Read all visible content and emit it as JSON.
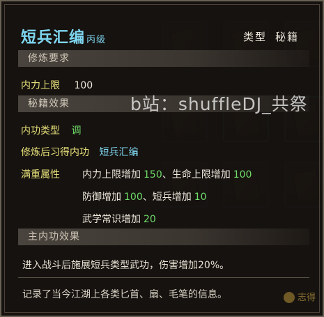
{
  "item": {
    "title": "短兵汇编",
    "title_suffix": "丙级",
    "type_heading": "类型",
    "type_value": "秘籍"
  },
  "sections": {
    "requirements": "修炼要求",
    "effects": "秘籍效果",
    "main_effect": "主内功效果"
  },
  "requirements": {
    "label": "内力上限",
    "value": "100"
  },
  "effects": {
    "inner_type_label": "内功类型",
    "inner_type_value": "调",
    "learned_label": "修炼后习得内功",
    "learned_value": "短兵汇编",
    "fullstack_label": "满重属性",
    "lines": [
      {
        "a_label": "内力上限增加",
        "a_value": "150",
        "sep": "、",
        "b_label": "生命上限增加",
        "b_value": "100"
      },
      {
        "a_label": "防御增加",
        "a_value": "100",
        "sep": "、",
        "b_label": "短兵增加",
        "b_value": "10"
      },
      {
        "a_label": "武学常识增加",
        "a_value": "20",
        "sep": "",
        "b_label": "",
        "b_value": ""
      }
    ]
  },
  "main_effect_text": "进入战斗后施展短兵类型武功，伤害增加20%。",
  "description": "记录了当今江湖上各类匕首、扇、毛笔的信息。",
  "watermark": "b站：shuffleDJ_共祭",
  "footer_logo": "志得"
}
